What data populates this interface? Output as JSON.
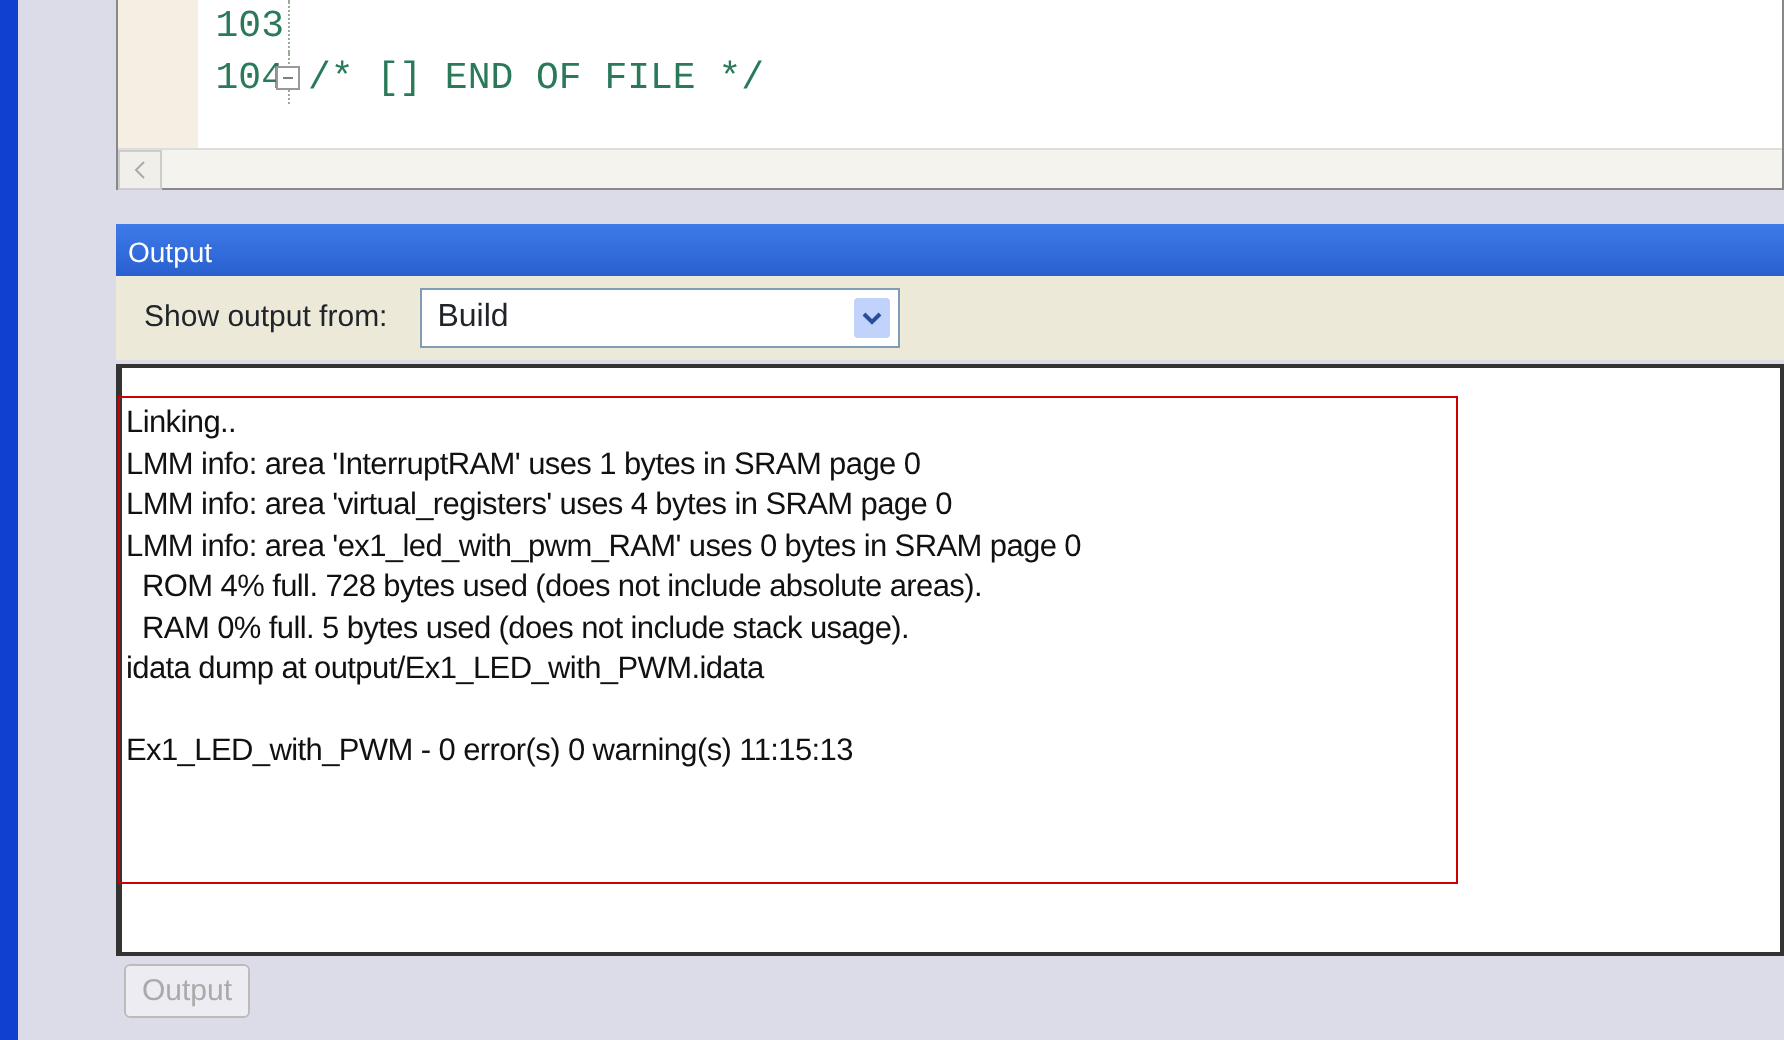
{
  "editor": {
    "lines": [
      {
        "number": "103",
        "foldable": false
      },
      {
        "number": "104",
        "text": "/* [] END OF FILE */",
        "foldable": true
      }
    ]
  },
  "output": {
    "title": "Output",
    "show_label": "Show output from:",
    "source": "Build",
    "lines": [
      {
        "text": "Linking..",
        "gap_before": false
      },
      {
        "text": "LMM info: area 'InterruptRAM' uses 1 bytes in SRAM page 0",
        "gap_before": false
      },
      {
        "text": "LMM info: area 'virtual_registers' uses 4 bytes in SRAM page 0",
        "gap_before": false
      },
      {
        "text": "LMM info: area 'ex1_led_with_pwm_RAM' uses 0 bytes in SRAM page 0",
        "gap_before": false
      },
      {
        "text": "  ROM 4% full. 728 bytes used (does not include absolute areas).",
        "gap_before": false
      },
      {
        "text": "  RAM 0% full. 5 bytes used (does not include stack usage).",
        "gap_before": false
      },
      {
        "text": "idata dump at output/Ex1_LED_with_PWM.idata",
        "gap_before": false
      },
      {
        "text": "Ex1_LED_with_PWM - 0 error(s) 0 warning(s) 11:15:13",
        "gap_before": true
      }
    ]
  },
  "tabs": [
    {
      "label": "Output",
      "selected": true
    }
  ]
}
